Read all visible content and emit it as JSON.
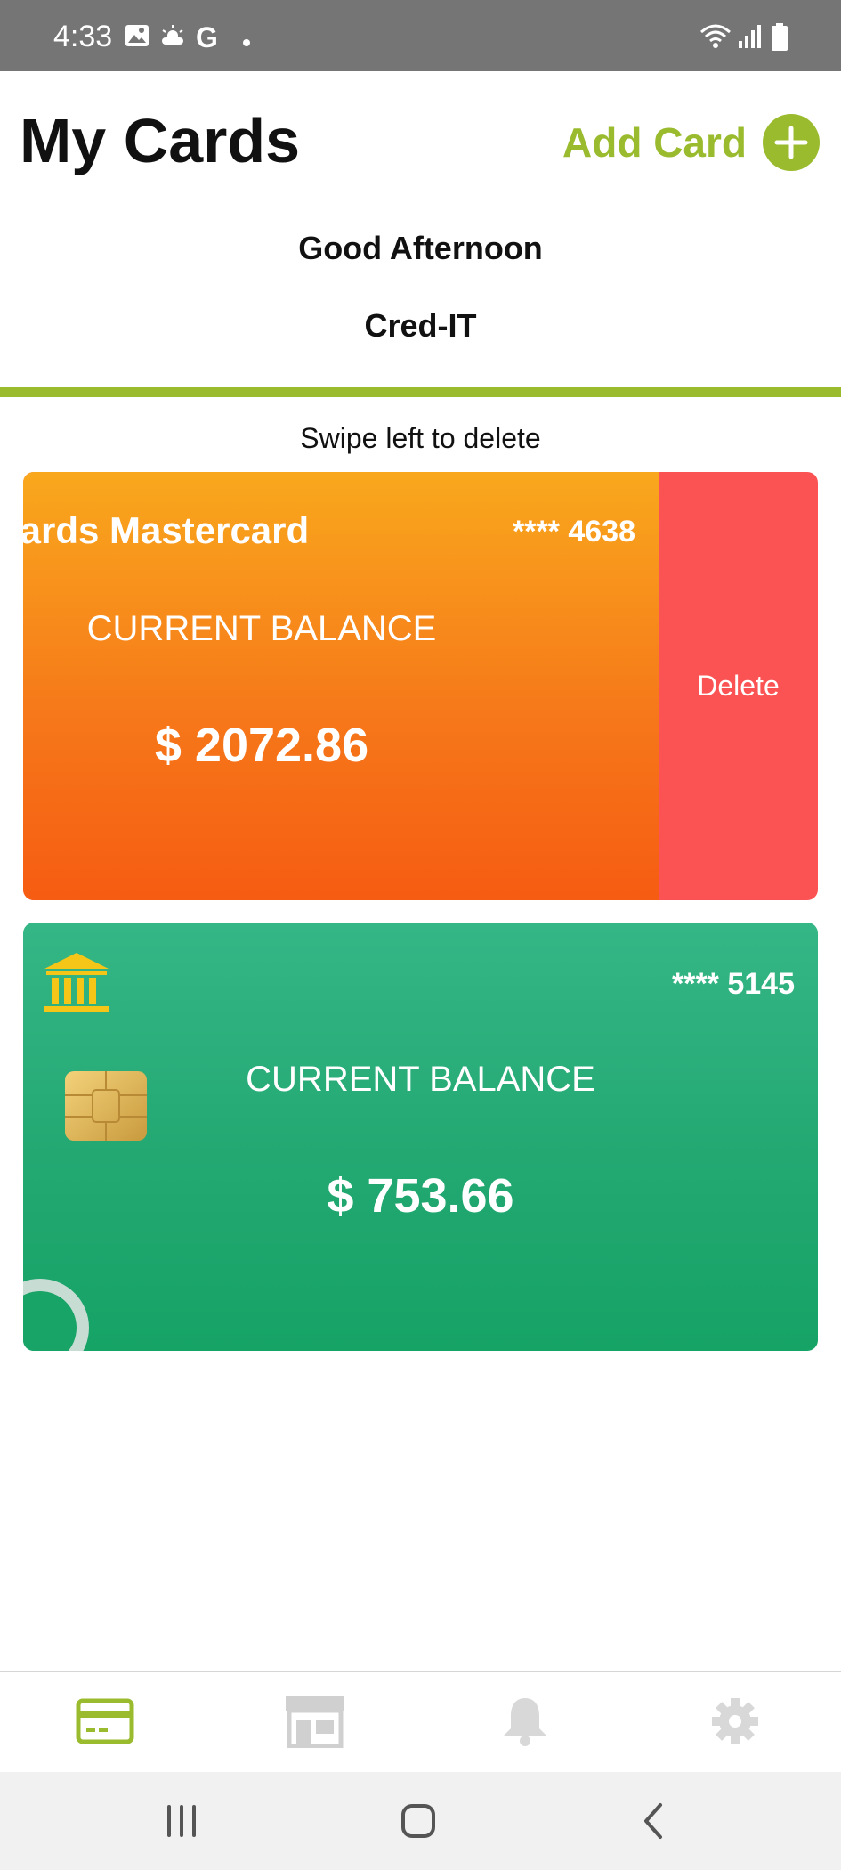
{
  "status_bar": {
    "time": "4:33",
    "left_icons": [
      "image-icon",
      "weather-icon",
      "google-icon",
      "dot-icon"
    ],
    "right_icons": [
      "wifi-icon",
      "signal-icon",
      "battery-icon"
    ]
  },
  "header": {
    "title": "My Cards",
    "add_card_label": "Add Card",
    "greeting": "Good Afternoon",
    "app_name": "Cred-IT"
  },
  "colors": {
    "accent": "#9abb2d",
    "delete": "#fb5353",
    "card1_gradient": [
      "#f9a81d",
      "#f65c12"
    ],
    "card2_gradient": [
      "#35b686",
      "#16a366"
    ],
    "bank_icon": "#f5c518"
  },
  "hint": "Swipe left to delete",
  "cards": [
    {
      "name": "wards Mastercard",
      "number": "**** 4638",
      "balance_label": "CURRENT BALANCE",
      "balance": "$ 2072.86",
      "delete_label": "Delete"
    },
    {
      "number": "**** 5145",
      "balance_label": "CURRENT BALANCE",
      "balance": "$ 753.66",
      "icons": [
        "bank-icon",
        "chip-icon"
      ]
    }
  ],
  "bottom_nav": {
    "items": [
      {
        "icon": "credit-card-icon",
        "active": true
      },
      {
        "icon": "store-icon",
        "active": false
      },
      {
        "icon": "bell-icon",
        "active": false
      },
      {
        "icon": "gear-icon",
        "active": false
      }
    ]
  },
  "system_nav": [
    "recents-icon",
    "home-icon",
    "back-icon"
  ]
}
